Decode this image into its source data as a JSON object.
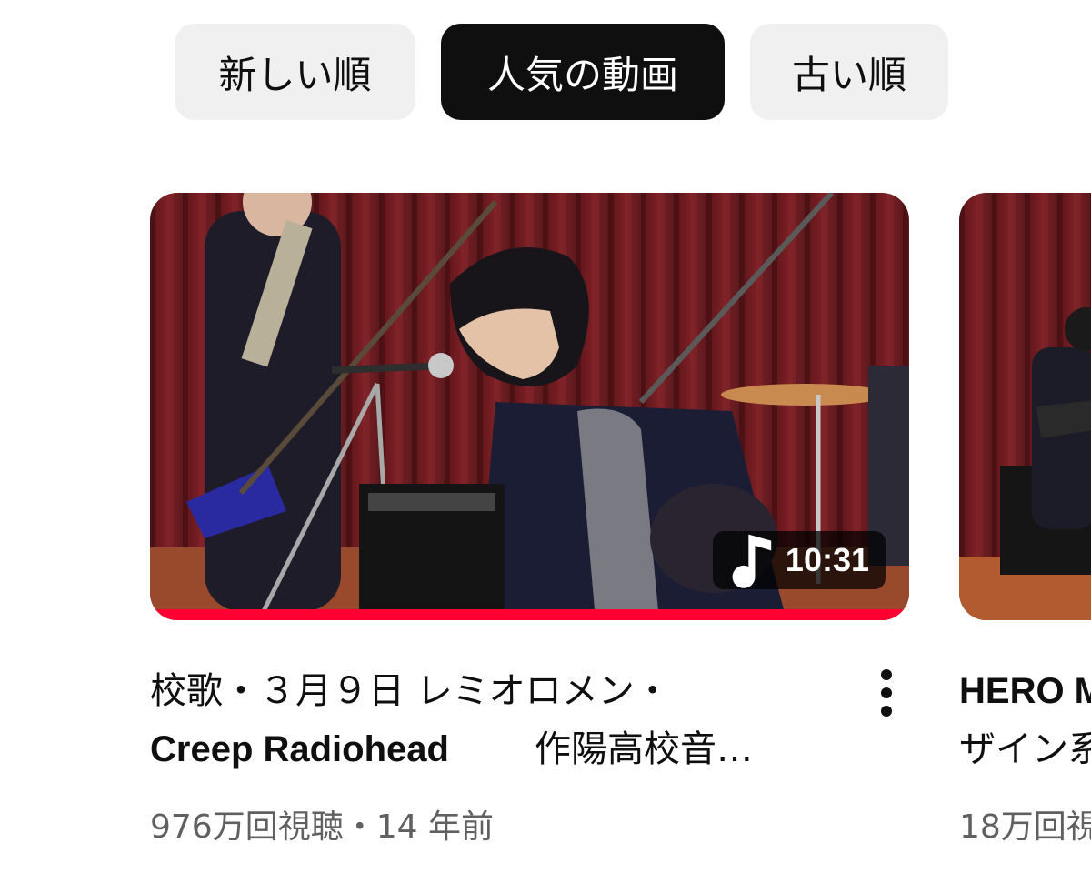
{
  "filters": [
    {
      "label": "新しい順",
      "active": false
    },
    {
      "label": "人気の動画",
      "active": true
    },
    {
      "label": "古い順",
      "active": false
    }
  ],
  "video": {
    "duration": "10:31",
    "duration_icon": "music-note-icon",
    "watch_progress": 1.0,
    "title_line1": "校歌・３月９日 レミオロメン・",
    "title_line2_latin": "Creep Radiohead",
    "title_line2_jp": "作陽高校音…",
    "meta": "976万回視聴・14 年前",
    "more_icon": "more-vertical-icon"
  },
  "next_video": {
    "title_line1": "HERO M",
    "title_line2": "ザイン系",
    "meta": "18万回視"
  },
  "colors": {
    "progress": "#ff0033",
    "chip_active_bg": "#0f0f0f",
    "chip_bg": "#f0f0f0",
    "meta_text": "#606060"
  }
}
